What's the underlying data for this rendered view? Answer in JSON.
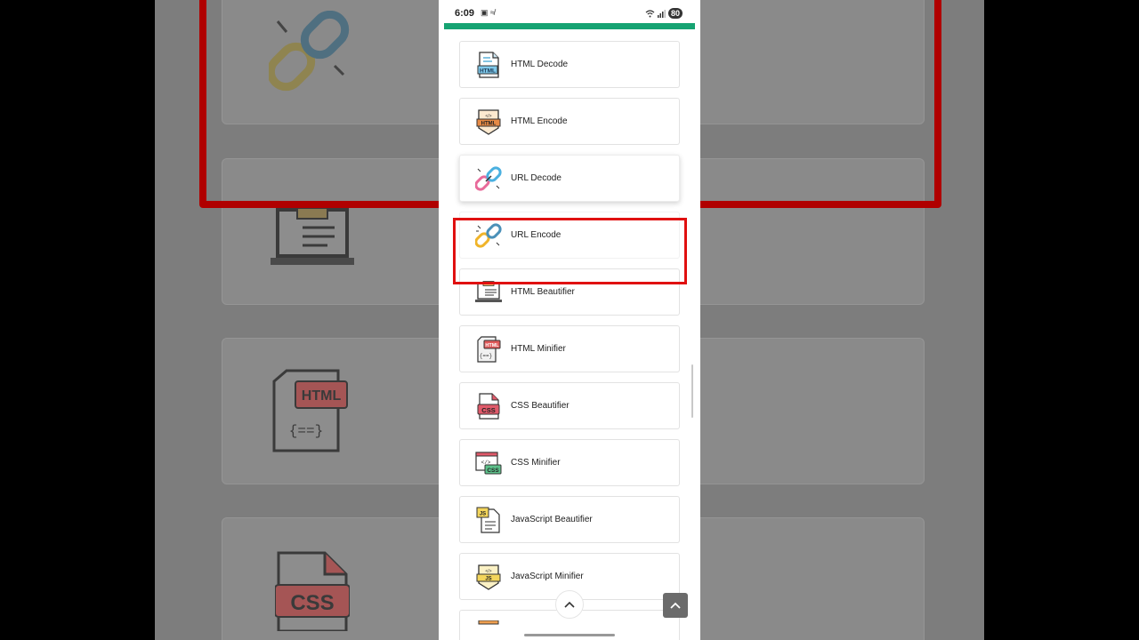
{
  "status_bar": {
    "time": "6:09",
    "left_icons": "▣ ≉",
    "battery": "80"
  },
  "colors": {
    "accent_bar": "#16a372",
    "highlight": "#e01010"
  },
  "tools": [
    {
      "label": "HTML Decode",
      "icon": "html-decode-icon"
    },
    {
      "label": "HTML Encode",
      "icon": "html-encode-icon"
    },
    {
      "label": "URL Decode",
      "icon": "url-decode-icon"
    },
    {
      "label": "URL Encode",
      "icon": "url-encode-icon"
    },
    {
      "label": "HTML Beautifier",
      "icon": "html-beautifier-icon"
    },
    {
      "label": "HTML Minifier",
      "icon": "html-minifier-icon"
    },
    {
      "label": "CSS Beautifier",
      "icon": "css-beautifier-icon"
    },
    {
      "label": "CSS Minifier",
      "icon": "css-minifier-icon"
    },
    {
      "label": "JavaScript Beautifier",
      "icon": "javascript-beautifier-icon"
    },
    {
      "label": "JavaScript Minifier",
      "icon": "javascript-minifier-icon"
    }
  ],
  "background_zoom": {
    "badge_html": "HTML",
    "badge_css": "CSS",
    "code_braces": "{==}"
  }
}
